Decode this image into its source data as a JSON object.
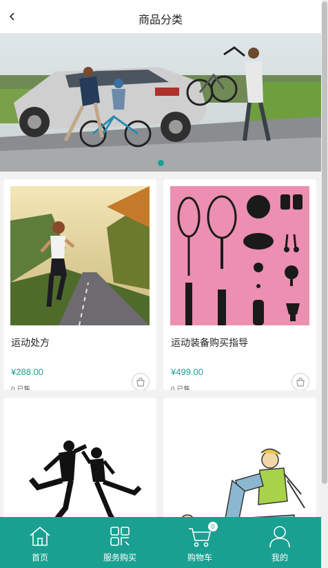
{
  "header": {
    "title": "商品分类"
  },
  "banner": {
    "active_dot": 1,
    "dot_count": 1
  },
  "products": [
    {
      "title": "运动处方",
      "price": "¥288.00",
      "sold": "0 已售"
    },
    {
      "title": "运动装备购买指导",
      "price": "¥499.00",
      "sold": "0 已售"
    },
    {
      "title": "",
      "price": "",
      "sold": ""
    },
    {
      "title": "",
      "price": "",
      "sold": ""
    }
  ],
  "tabbar": {
    "items": [
      {
        "label": "首页",
        "icon": "home-icon"
      },
      {
        "label": "服务购买",
        "icon": "grid-icon"
      },
      {
        "label": "购物车",
        "icon": "cart-icon",
        "badge": "0"
      },
      {
        "label": "我的",
        "icon": "user-icon"
      }
    ]
  },
  "colors": {
    "accent": "#1aa091",
    "background": "#f2f2f2"
  }
}
